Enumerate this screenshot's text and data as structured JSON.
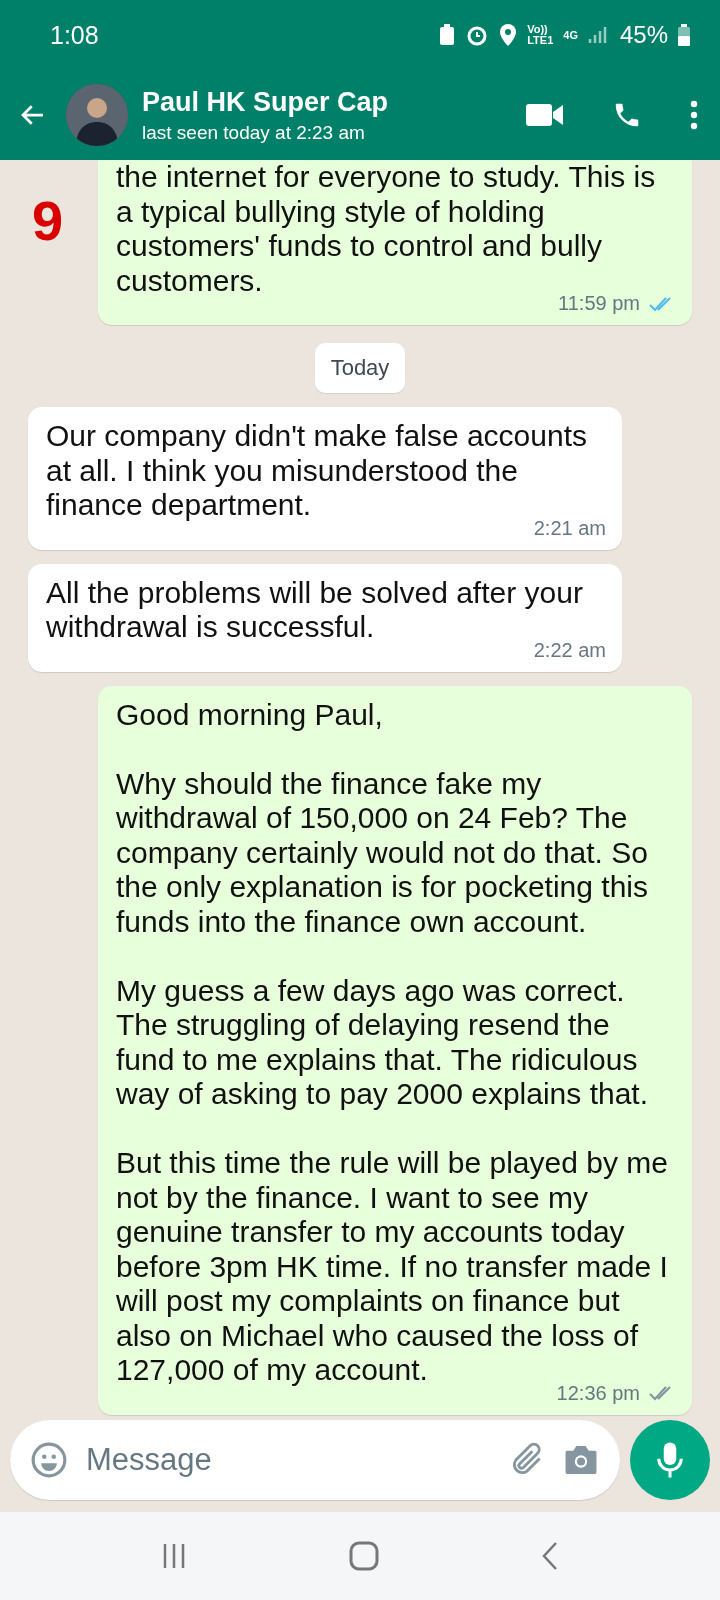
{
  "status_bar": {
    "time": "1:08",
    "battery": "45%",
    "network_top": "Vo))",
    "network_bottom": "LTE1",
    "network_type": "4G"
  },
  "header": {
    "name": "Paul HK Super Cap",
    "subtitle": "last seen today at 2:23 am"
  },
  "annotation": "9",
  "messages": [
    {
      "kind": "outgoing",
      "text": "the internet for everyone to study. This is a typical bullying style of holding customers' funds to control and bully customers.",
      "time": "11:59 pm",
      "read": true,
      "cut_top": true
    },
    {
      "kind": "date",
      "text": "Today"
    },
    {
      "kind": "incoming",
      "text": "Our company didn't make false accounts at all. I think you misunderstood the finance department.",
      "time": "2:21 am"
    },
    {
      "kind": "incoming",
      "text": "All the problems will be solved after your withdrawal is successful.",
      "time": "2:22 am"
    },
    {
      "kind": "outgoing",
      "text": "Good morning Paul,\n\nWhy should the finance fake my withdrawal of 150,000 on 24 Feb? The company certainly would not do that. So the only explanation is for pocketing this funds into the finance own account.\n\nMy guess a few days ago was correct. The struggling of delaying resend the fund to me explains that. The ridiculous way of asking to pay 2000 explains that.\n\nBut this time the rule will be played by me not by the finance. I want to see my genuine transfer to my accounts today before 3pm HK time. If no transfer made I will post my complaints on finance but also on Michael who caused the loss of 127,000 of my account.",
      "time": "12:36 pm",
      "read": false,
      "cut_top": false
    }
  ],
  "composer": {
    "placeholder": "Message"
  }
}
